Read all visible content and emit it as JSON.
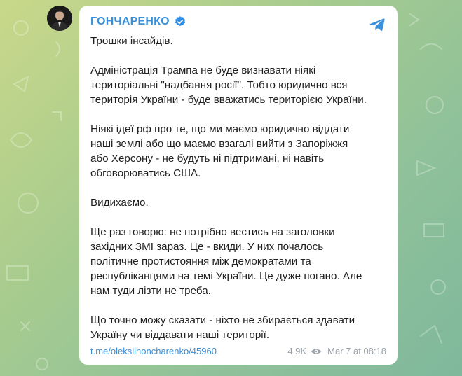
{
  "post": {
    "channel_name": "ГОНЧАРЕНКО",
    "paragraphs": [
      "Трошки інсайдів.",
      "Адміністрація Трампа не буде визнавати ніякі\nтериторіальні \"надбання росії\". Тобто юридично вся\nтериторія України - буде вважатись територією України.",
      "Ніякі ідеї рф про те, що ми маємо юридично віддати\nнаші землі або що маємо взагалі вийти з Запоріжжя\nабо Херсону - не будуть ні підтримані, ні навіть\nобговорюватись США.",
      "Видихаємо.",
      "Ще раз говорю: не потрібно вестись на заголовки\nзахідних ЗМІ зараз. Це - вкиди. У них почалось\nполітичне протистояння між демократами та\nреспубліканцями на темі України. Це дуже погано. Але\nнам туди лізти не треба.",
      "Що точно можу сказати - ніхто не збирається здавати\nУкраїну чи віддавати наші території."
    ],
    "link": "t.me/oleksiihoncharenko/45960",
    "views": "4.9K",
    "date": "Mar 7 at 08:18"
  },
  "icons": {
    "verified": "verified-badge-icon",
    "share": "telegram-share-icon",
    "views": "eye-icon"
  },
  "colors": {
    "accent": "#3a8fd9",
    "verified": "#2f8fe6",
    "meta": "#9aa1a8"
  }
}
